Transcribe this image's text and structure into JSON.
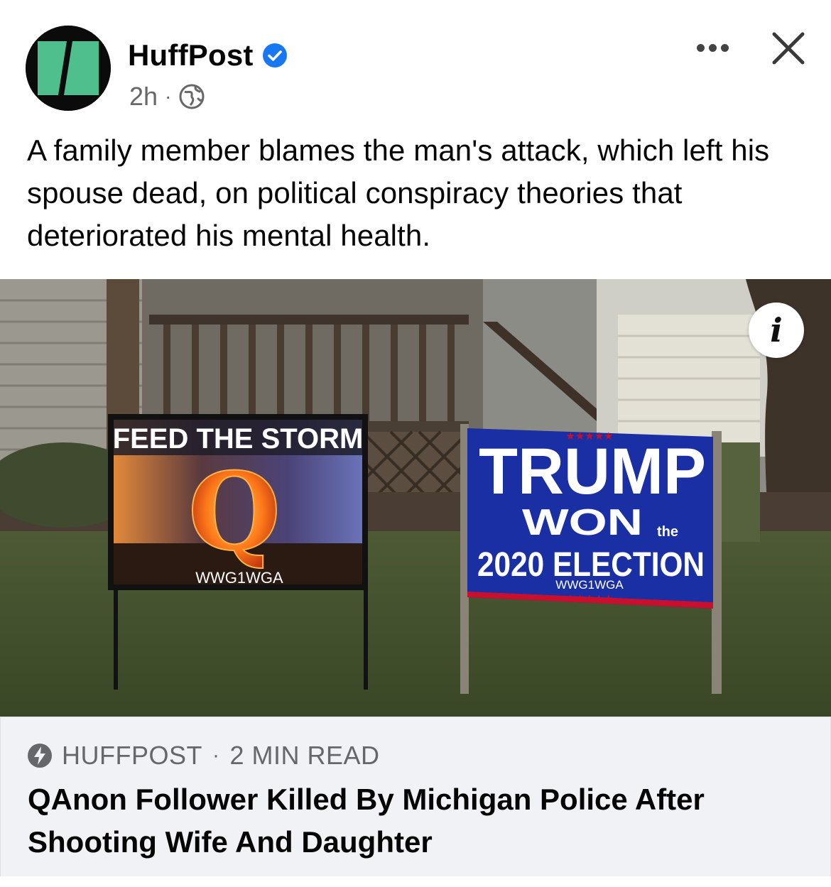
{
  "post": {
    "page_name": "HuffPost",
    "time": "2h",
    "separator": "·",
    "caption": "A family member blames the man's attack, which left his spouse dead, on political conspiracy theories that deteriorated his mental health."
  },
  "photo": {
    "sign_left": {
      "headline": "FEED THE STORM",
      "letter": "Q",
      "footer": "WWG1WGA"
    },
    "sign_right": {
      "line1": "TRUMP",
      "line2": "WON",
      "line2_small": "the",
      "line3": "2020 ELECTION",
      "footer": "WWG1WGA",
      "stars": "★★★★★"
    },
    "info_label": "i"
  },
  "link": {
    "source": "HUFFPOST",
    "separator": "·",
    "read_time": "2 MIN READ",
    "headline": "QAnon Follower Killed By Michigan Police After Shooting Wife And Daughter"
  },
  "icons": {
    "avatar": "huffpost-logo-icon",
    "verified": "verified-badge-icon",
    "privacy": "globe-icon",
    "more": "more-options-icon",
    "close": "close-icon",
    "info": "info-icon",
    "instant": "lightning-bolt-icon"
  },
  "colors": {
    "brand_green": "#4fc08d",
    "verified_blue": "#1877f2",
    "secondary_text": "#65676b",
    "link_bg": "#f0f2f5",
    "sign_blue": "#1a2fa3",
    "sign_red": "#c8102e"
  }
}
